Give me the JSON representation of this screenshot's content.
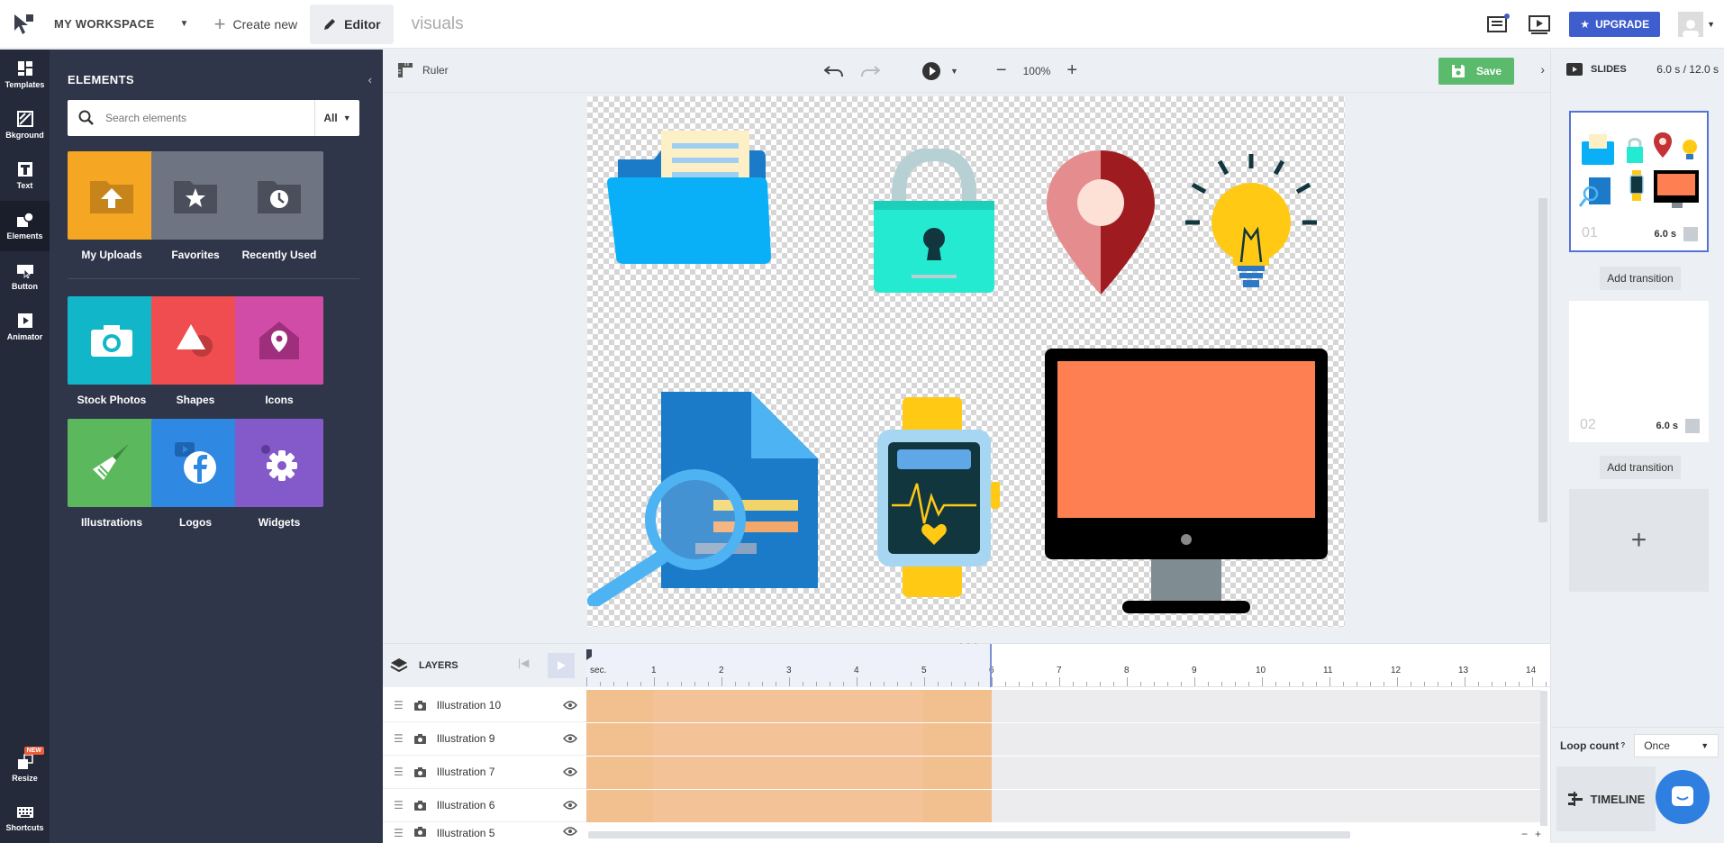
{
  "topbar": {
    "workspace": "MY WORKSPACE",
    "create_new": "Create new",
    "editor": "Editor",
    "project_name": "visuals",
    "upgrade": "UPGRADE"
  },
  "rail": [
    {
      "label": "Templates",
      "icon": "templates-icon"
    },
    {
      "label": "Bkground",
      "icon": "background-icon"
    },
    {
      "label": "Text",
      "icon": "text-icon"
    },
    {
      "label": "Elements",
      "icon": "elements-icon"
    },
    {
      "label": "Button",
      "icon": "button-icon"
    },
    {
      "label": "Animator",
      "icon": "animator-icon"
    },
    {
      "label": "Resize",
      "icon": "resize-icon",
      "badge": "NEW"
    },
    {
      "label": "Shortcuts",
      "icon": "keyboard-icon"
    }
  ],
  "panel": {
    "title": "ELEMENTS",
    "search_placeholder": "Search elements",
    "filter": "All",
    "tiles": [
      {
        "label": "My Uploads",
        "color": "#f5a623"
      },
      {
        "label": "Favorites",
        "color": "#6e7482"
      },
      {
        "label": "Recently Used",
        "color": "#6e7482"
      },
      {
        "label": "Stock Photos",
        "color": "#11b6c9"
      },
      {
        "label": "Shapes",
        "color": "#f04d51"
      },
      {
        "label": "Icons",
        "color": "#d14ca7"
      },
      {
        "label": "Illustrations",
        "color": "#5cb85c"
      },
      {
        "label": "Logos",
        "color": "#2f88e2"
      },
      {
        "label": "Widgets",
        "color": "#8459c9"
      }
    ]
  },
  "toolbar": {
    "ruler": "Ruler",
    "zoom": "100%",
    "save": "Save"
  },
  "slides": {
    "title": "SLIDES",
    "duration": "6.0 s / 12.0 s",
    "items": [
      {
        "num": "01",
        "dur": "6.0 s"
      },
      {
        "num": "02",
        "dur": "6.0 s"
      }
    ],
    "add_transition": "Add transition",
    "add_slide": "+",
    "loop_label": "Loop count",
    "loop_help": "?",
    "loop_value": "Once",
    "timeline_btn": "TIMELINE"
  },
  "timeline": {
    "layers_title": "LAYERS",
    "ruler_start": "sec.",
    "ticks": [
      "1",
      "2",
      "3",
      "4",
      "5",
      "6",
      "7",
      "8",
      "9",
      "10",
      "11",
      "12",
      "13",
      "14"
    ],
    "layers": [
      "Illustration 10",
      "Illustration 9",
      "Illustration 7",
      "Illustration 6",
      "Illustration 5"
    ],
    "zoom_minus": "−",
    "zoom_plus": "+"
  }
}
